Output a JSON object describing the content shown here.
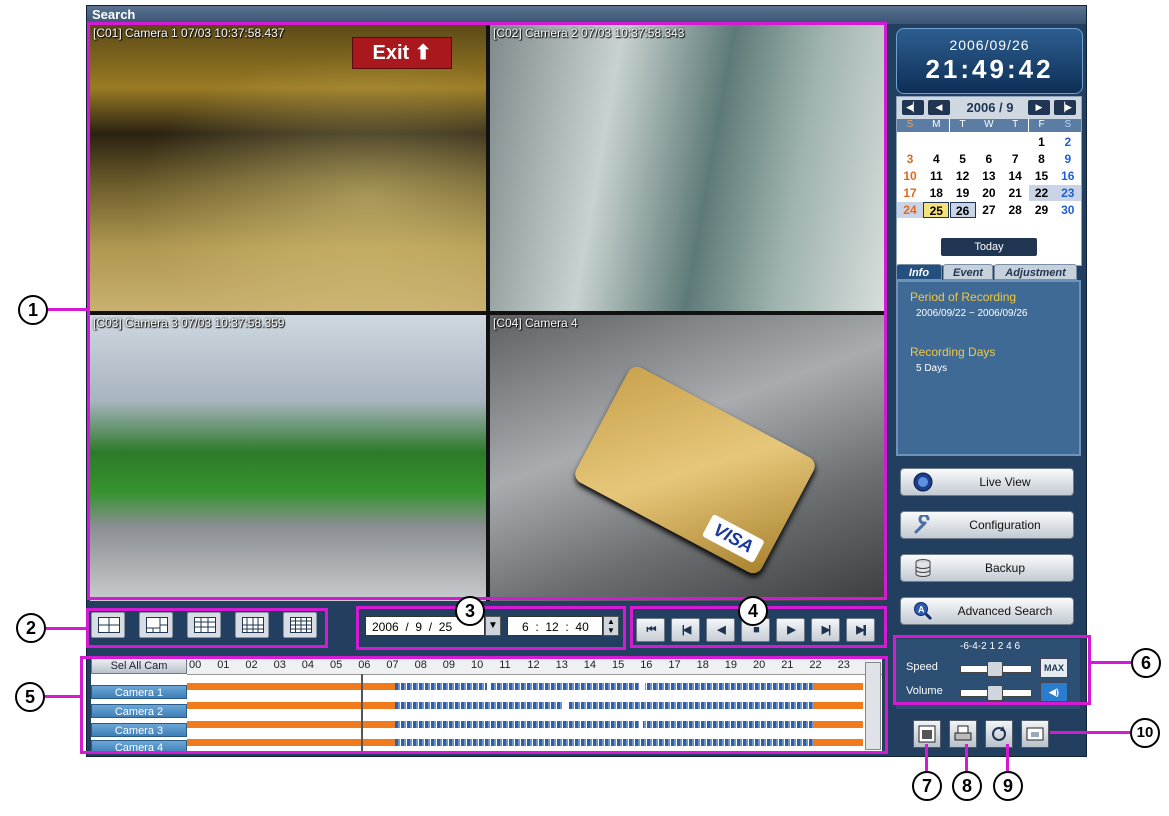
{
  "window": {
    "title": "Search"
  },
  "cameras": [
    {
      "overlay": "[C01] Camera 1 07/03 10:37:58.437",
      "sign": "Exit"
    },
    {
      "overlay": "[C02] Camera 2 07/03 10:37:58.343"
    },
    {
      "overlay": "[C03] Camera 3 07/03 10:37:58.359"
    },
    {
      "overlay": "[C04] Camera 4",
      "card_brand": "VISA"
    }
  ],
  "search_time": {
    "year": "2006",
    "month": "9",
    "day": "25",
    "hour": "6",
    "minute": "12",
    "second": "40",
    "sep_date": "/",
    "sep_time": ":"
  },
  "timeline": {
    "select_all": "Sel All Cam",
    "hours": [
      "00",
      "01",
      "02",
      "03",
      "04",
      "05",
      "06",
      "07",
      "08",
      "09",
      "10",
      "11",
      "12",
      "13",
      "14",
      "15",
      "16",
      "17",
      "18",
      "19",
      "20",
      "21",
      "22",
      "23"
    ],
    "cameras": [
      "Camera 1",
      "Camera 2",
      "Camera 3",
      "Camera 4"
    ]
  },
  "clock": {
    "date": "2006/09/26",
    "time": "21:49:42"
  },
  "calendar": {
    "title": "2006 / 9",
    "weekdays": [
      "S",
      "M",
      "T",
      "W",
      "T",
      "F",
      "S"
    ],
    "weeks": [
      [
        "",
        "",
        "",
        "",
        "",
        "1",
        "2"
      ],
      [
        "3",
        "4",
        "5",
        "6",
        "7",
        "8",
        "9"
      ],
      [
        "10",
        "11",
        "12",
        "13",
        "14",
        "15",
        "16"
      ],
      [
        "17",
        "18",
        "19",
        "20",
        "21",
        "22",
        "23"
      ],
      [
        "24",
        "25",
        "26",
        "27",
        "28",
        "29",
        "30"
      ]
    ],
    "today_label": "Today",
    "nav": [
      "◀▏",
      "◀",
      "▶",
      "▕▶"
    ]
  },
  "tabs": [
    "Info",
    "Event",
    "Adjustment"
  ],
  "info": {
    "period_label": "Period of Recording",
    "period_value": "2006/09/22 ~ 2006/09/26",
    "days_label": "Recording Days",
    "days_value": "5 Days"
  },
  "nav_buttons": [
    "Live View",
    "Configuration",
    "Backup",
    "Advanced Search"
  ],
  "speed": {
    "label": "Speed",
    "scale": "-6-4-2 1 2 4 6",
    "max_label": "MAX"
  },
  "volume": {
    "label": "Volume"
  },
  "playback": [
    "⏮",
    "|◀",
    "◀",
    "■",
    "▶",
    "▶|",
    "▶||"
  ],
  "callouts": [
    "1",
    "2",
    "3",
    "4",
    "5",
    "6",
    "7",
    "8",
    "9",
    "10"
  ],
  "colors": {
    "highlight": "#d41ad2",
    "recording": "#f07a1c",
    "event": "#2e5fa8"
  }
}
